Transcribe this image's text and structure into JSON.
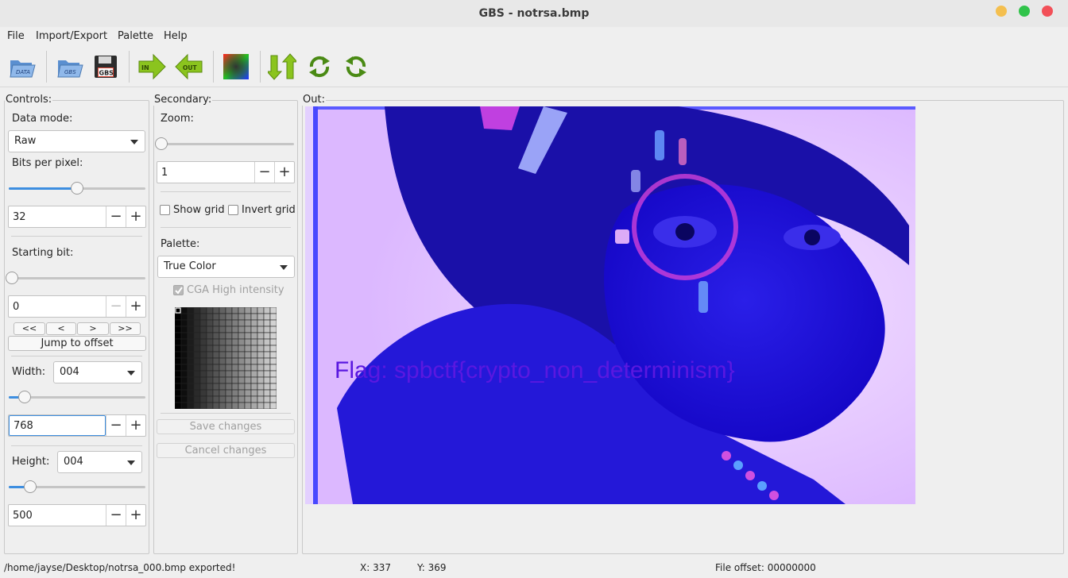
{
  "window": {
    "title": "GBS - notrsa.bmp",
    "buttons": [
      {
        "name": "minimize",
        "color": "#f4bf4f"
      },
      {
        "name": "maximize",
        "color": "#30c34a"
      },
      {
        "name": "close",
        "color": "#f25058"
      }
    ]
  },
  "menu": [
    "File",
    "Import/Export",
    "Palette",
    "Help"
  ],
  "toolbar": {
    "buttons": [
      {
        "name": "open-data",
        "label": "DATA",
        "icon": "folder-open-icon"
      },
      {
        "name": "open-gbs",
        "label": "GBS",
        "icon": "folder-open-icon"
      },
      {
        "name": "save-gbs",
        "label": "GBS",
        "icon": "floppy-disk-icon"
      },
      {
        "name": "import",
        "label": "IN",
        "icon": "arrow-right-icon"
      },
      {
        "name": "export",
        "label": "OUT",
        "icon": "arrow-left-icon"
      },
      {
        "name": "palette",
        "icon": "color-gradient-icon"
      },
      {
        "name": "swap",
        "icon": "up-down-arrows-icon"
      },
      {
        "name": "rotate-ccw",
        "icon": "rotate-left-icon"
      },
      {
        "name": "rotate-cw",
        "icon": "rotate-right-icon"
      }
    ]
  },
  "controls": {
    "title": "Controls:",
    "data_mode_label": "Data mode:",
    "data_mode_value": "Raw",
    "bpp_label": "Bits per pixel:",
    "bpp_slider_fraction": 0.5,
    "bpp_value": "32",
    "starting_bit_label": "Starting bit:",
    "starting_bit_slider_fraction": 0,
    "starting_bit_value": "0",
    "nav_buttons": [
      "<<",
      "<",
      ">",
      ">>"
    ],
    "jump_label": "Jump to offset",
    "width_label": "Width:",
    "width_combo": "004",
    "width_slider_fraction": 0.08,
    "width_value": "768",
    "height_label": "Height:",
    "height_combo": "004",
    "height_slider_fraction": 0.12,
    "height_value": "500"
  },
  "secondary": {
    "title": "Secondary:",
    "zoom_label": "Zoom:",
    "zoom_slider_fraction": 0,
    "zoom_value": "1",
    "show_grid_label": "Show grid",
    "show_grid_checked": false,
    "invert_grid_label": "Invert grid",
    "invert_grid_checked": false,
    "palette_label": "Palette:",
    "palette_value": "True Color",
    "cga_label": "CGA High intensity",
    "cga_checked": true,
    "save_label": "Save changes",
    "cancel_label": "Cancel changes"
  },
  "out": {
    "title": "Out:",
    "image_text": "Flag: spbctf{crypto_non_determinism}"
  },
  "status": {
    "message": "/home/jayse/Desktop/notrsa_000.bmp exported!",
    "x": "X: 337",
    "y": "Y: 369",
    "offset": "File offset: 00000000"
  }
}
